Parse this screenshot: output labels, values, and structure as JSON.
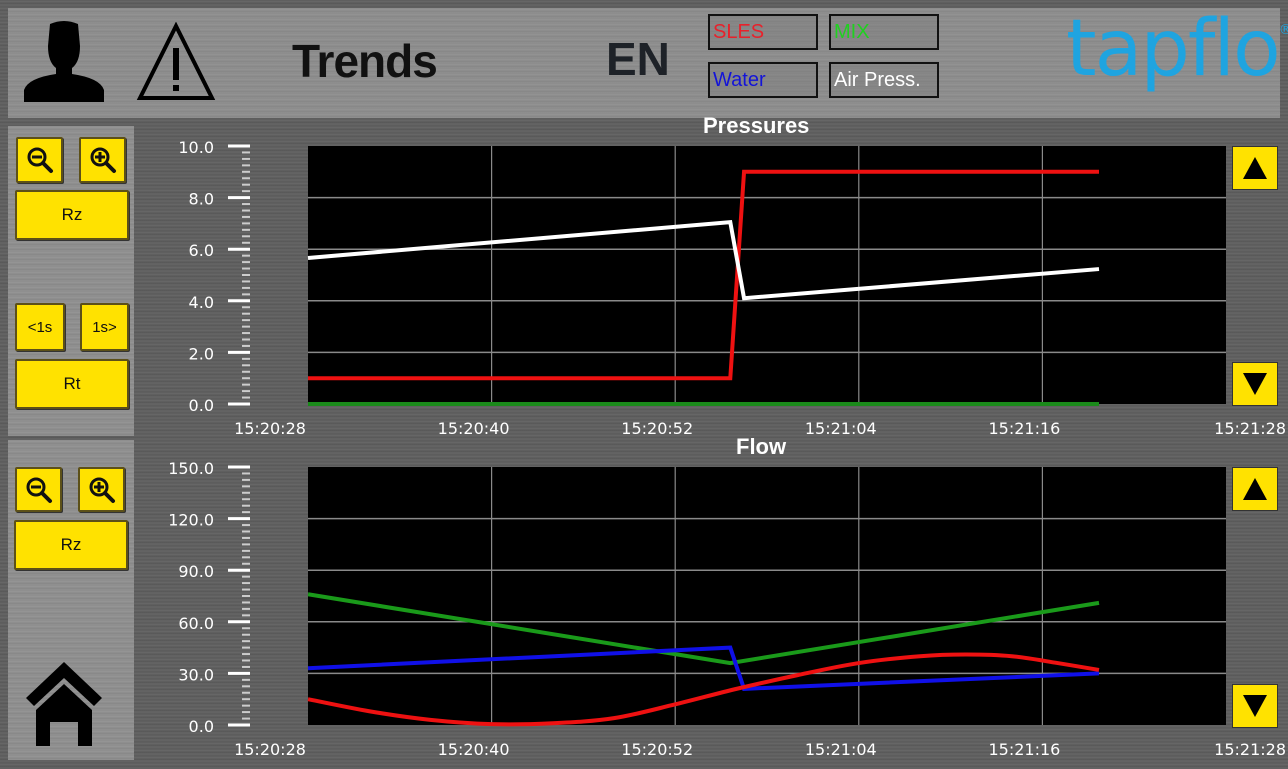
{
  "header": {
    "title": "Trends",
    "language": "EN",
    "logo_text": "tapflo",
    "logo_mark": "®",
    "legend": [
      {
        "label": "SLES",
        "color": "#e8212b"
      },
      {
        "label": "MIX",
        "color": "#20d020"
      },
      {
        "label": "Water",
        "color": "#1414d8"
      },
      {
        "label": "Air Press.",
        "color": "#ffffff"
      }
    ],
    "icons": [
      "user-icon",
      "warning-icon"
    ]
  },
  "pressure_controls": {
    "zoom_out": "zoom-out-icon",
    "zoom_in": "zoom-in-icon",
    "reset_zoom": "Rz",
    "back_1s": "<1s",
    "forward_1s": "1s>",
    "reset_time": "Rt"
  },
  "flow_controls": {
    "zoom_out": "zoom-out-icon",
    "zoom_in": "zoom-in-icon",
    "reset_zoom": "Rz"
  },
  "nav": {
    "home": "home-icon"
  },
  "chart_data": [
    {
      "type": "line",
      "title": "Pressures",
      "xlabel": "",
      "ylabel": "",
      "ylim": [
        0,
        10
      ],
      "yticks": [
        "0.0",
        "2.0",
        "4.0",
        "6.0",
        "8.0",
        "10.0"
      ],
      "xlim_seconds": [
        0,
        60
      ],
      "xticks": [
        "15:20:28",
        "15:20:40",
        "15:20:52",
        "15:21:04",
        "15:21:16",
        "15:21:28"
      ],
      "grid": true,
      "series": [
        {
          "name": "SLES",
          "color": "#ee1111",
          "x": [
            0,
            27.6,
            28.5,
            51.7
          ],
          "y": [
            1.0,
            1.0,
            9.0,
            9.0
          ]
        },
        {
          "name": "MIX",
          "color": "#1a8a1a",
          "x": [
            0,
            51.7
          ],
          "y": [
            0.0,
            0.0
          ]
        },
        {
          "name": "Air Press.",
          "color": "#ffffff",
          "x": [
            0,
            27.6,
            28.5,
            51.7
          ],
          "y": [
            5.66,
            7.05,
            4.1,
            5.23
          ]
        }
      ]
    },
    {
      "type": "line",
      "title": "Flow",
      "xlabel": "",
      "ylabel": "",
      "ylim": [
        0,
        150
      ],
      "yticks": [
        "0.0",
        "30.0",
        "60.0",
        "90.0",
        "120.0",
        "150.0"
      ],
      "xlim_seconds": [
        0,
        60
      ],
      "xticks": [
        "15:20:28",
        "15:20:40",
        "15:20:52",
        "15:21:04",
        "15:21:16",
        "15:21:28"
      ],
      "grid": true,
      "series": [
        {
          "name": "MIX",
          "color": "#1a9a1a",
          "x": [
            0,
            27.6,
            51.7
          ],
          "y": [
            76,
            36,
            71
          ]
        },
        {
          "name": "Water",
          "color": "#1010e8",
          "x": [
            0,
            27.6,
            28.5,
            51.7
          ],
          "y": [
            33,
            45,
            21,
            30
          ]
        },
        {
          "name": "SLES",
          "color": "#ee1111",
          "x": [
            0,
            4,
            8,
            12,
            16,
            20,
            24,
            28,
            32,
            36,
            40,
            43,
            46,
            49,
            51.7
          ],
          "y": [
            15,
            8,
            3,
            0.5,
            1,
            4,
            12,
            21,
            29,
            36,
            40,
            41,
            40,
            36,
            32
          ]
        }
      ]
    }
  ]
}
